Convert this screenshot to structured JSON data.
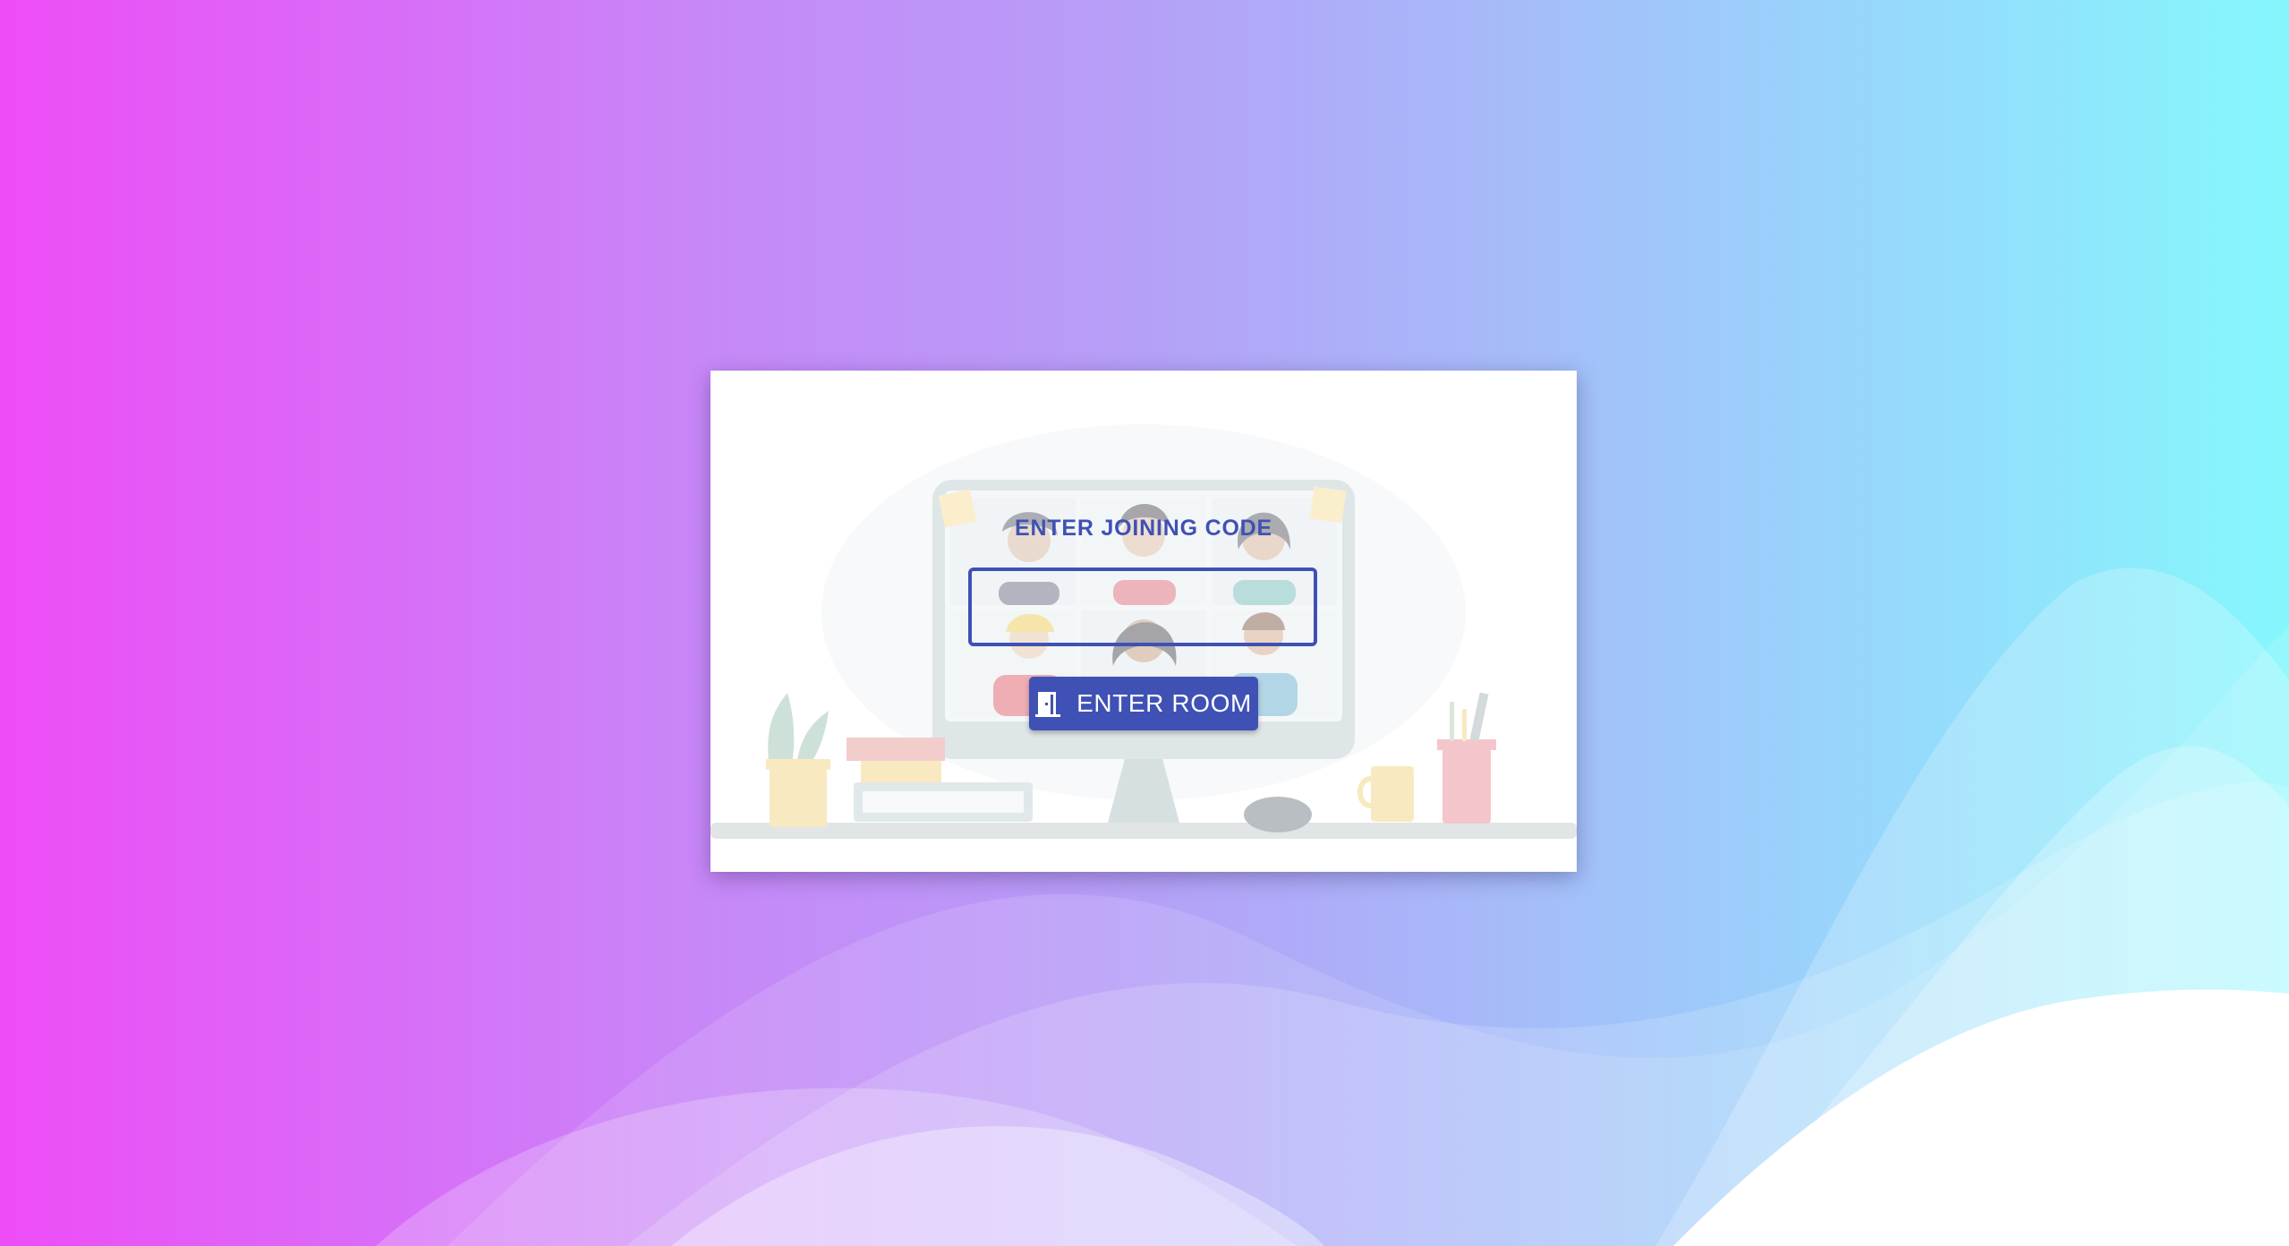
{
  "join_panel": {
    "heading": "ENTER JOINING CODE",
    "code_value": "",
    "code_placeholder": "",
    "enter_button_label": "ENTER ROOM",
    "enter_button_icon": "door-icon"
  },
  "theme": {
    "accent": "#3f51b5",
    "gradient_left": "#ee4cf7",
    "gradient_right": "#86f7fd"
  }
}
